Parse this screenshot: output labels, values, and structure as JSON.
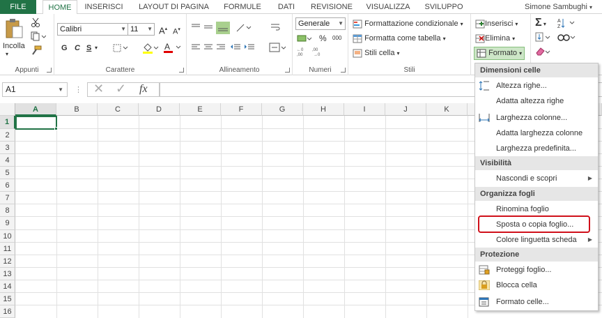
{
  "tabs": [
    "FILE",
    "HOME",
    "INSERISCI",
    "LAYOUT DI PAGINA",
    "FORMULE",
    "DATI",
    "REVISIONE",
    "VISUALIZZA",
    "SVILUPPO"
  ],
  "user": "Simone Sambughi",
  "groups": {
    "clipboard": {
      "label": "Appunti",
      "paste": "Incolla"
    },
    "font": {
      "label": "Carattere",
      "name": "Calibri",
      "size": "11",
      "bold": "G",
      "italic": "C",
      "underline": "S"
    },
    "align": {
      "label": "Allineamento"
    },
    "number": {
      "label": "Numeri",
      "format": "Generale",
      "percent": "%",
      "thousands": "000"
    },
    "styles": {
      "label": "Stili",
      "cond": "Formattazione condizionale",
      "table": "Formatta come tabella",
      "cell": "Stili cella"
    },
    "cells": {
      "insert": "Inserisci",
      "delete": "Elimina",
      "format": "Formato"
    }
  },
  "namebox": "A1",
  "fx": "fx",
  "columns": [
    "A",
    "B",
    "C",
    "D",
    "E",
    "F",
    "G",
    "H",
    "I",
    "J",
    "K"
  ],
  "rows": [
    "1",
    "2",
    "3",
    "4",
    "5",
    "6",
    "7",
    "8",
    "9",
    "10",
    "11",
    "12",
    "13",
    "14",
    "15",
    "16"
  ],
  "menu": {
    "sections": [
      {
        "header": "Dimensioni celle",
        "items": [
          "Altezza righe...",
          "Adatta altezza righe",
          "Larghezza colonne...",
          "Adatta larghezza colonne",
          "Larghezza predefinita..."
        ]
      },
      {
        "header": "Visibilità",
        "items": [
          "Nascondi e scopri"
        ]
      },
      {
        "header": "Organizza fogli",
        "items": [
          "Rinomina foglio",
          "Sposta o copia foglio...",
          "Colore linguetta scheda"
        ]
      },
      {
        "header": "Protezione",
        "items": [
          "Proteggi foglio...",
          "Blocca cella",
          "Formato celle..."
        ]
      }
    ]
  },
  "colors": {
    "brand": "#217346",
    "highlight": "#d0101a"
  }
}
